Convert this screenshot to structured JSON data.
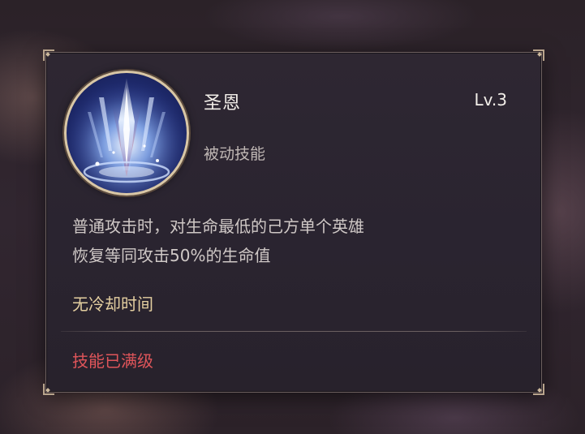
{
  "tooltip": {
    "skill_name": "圣恩",
    "skill_level": "Lv.3",
    "skill_type": "被动技能",
    "description_lines": [
      "普通攻击时，对生命最低的己方单个英雄",
      "恢复等同攻击50%的生命值"
    ],
    "cooldown_text": "无冷却时间",
    "max_level_text": "技能已满级",
    "icon": "holy-light-skill-icon"
  },
  "colors": {
    "panel_background": "#2b2530",
    "panel_border": "#6e6160",
    "name_text": "#f2eee9",
    "type_text": "#bfb7b4",
    "description_text": "#cfc8c6",
    "cooldown_text": "#e4cfa0",
    "max_level_text": "#e0555a",
    "icon_ring": "#d9c7a6"
  }
}
